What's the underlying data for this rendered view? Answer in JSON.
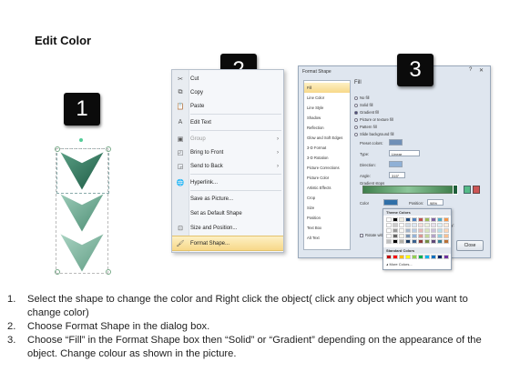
{
  "title": "Edit Color",
  "badges": [
    "1",
    "2",
    "3"
  ],
  "context_menu": {
    "items": [
      {
        "label": "Cut",
        "icon": "scissors-icon",
        "disabled": false,
        "submenu": false
      },
      {
        "label": "Copy",
        "icon": "copy-icon",
        "disabled": false,
        "submenu": false
      },
      {
        "label": "Paste",
        "icon": "paste-icon",
        "disabled": false,
        "submenu": false
      },
      {
        "label": "Edit Text",
        "icon": "text-edit-icon",
        "disabled": false,
        "submenu": false
      },
      {
        "label": "Group",
        "icon": "group-icon",
        "disabled": true,
        "submenu": true
      },
      {
        "label": "Bring to Front",
        "icon": "bring-front-icon",
        "disabled": false,
        "submenu": true
      },
      {
        "label": "Send to Back",
        "icon": "send-back-icon",
        "disabled": false,
        "submenu": true
      },
      {
        "label": "Hyperlink...",
        "icon": "hyperlink-icon",
        "disabled": false,
        "submenu": false
      },
      {
        "label": "Save as Picture...",
        "icon": "",
        "disabled": false,
        "submenu": false
      },
      {
        "label": "Set as Default Shape",
        "icon": "",
        "disabled": false,
        "submenu": false
      },
      {
        "label": "Size and Position...",
        "icon": "size-position-icon",
        "disabled": false,
        "submenu": false
      },
      {
        "label": "Format Shape...",
        "icon": "format-shape-icon",
        "disabled": false,
        "submenu": false,
        "highlighted": true
      }
    ]
  },
  "format_dialog": {
    "title": "Format Shape",
    "categories": [
      "Fill",
      "Line Color",
      "Line Style",
      "Shadow",
      "Reflection",
      "Glow and Soft Edges",
      "3-D Format",
      "3-D Rotation",
      "Picture Corrections",
      "Picture Color",
      "Artistic Effects",
      "Crop",
      "Size",
      "Position",
      "Text Box",
      "Alt Text"
    ],
    "selected_category": "Fill",
    "fill_heading": "Fill",
    "fill_options": [
      "No fill",
      "Solid fill",
      "Gradient fill",
      "Picture or texture fill",
      "Pattern fill",
      "Slide background fill"
    ],
    "selected_fill": "Gradient fill",
    "preset_colors_label": "Preset colors:",
    "type_label": "Type:",
    "type_value": "Linear",
    "direction_label": "Direction:",
    "angle_label": "Angle:",
    "angle_value": "315°",
    "gradient_stops_label": "Gradient stops",
    "color_label": "Color",
    "position_label": "Position:",
    "position_value": "98%",
    "brightness_label": "Brightness:",
    "transparency_label": "Transparency:",
    "rotate_label": "Rotate with shape",
    "close_label": "Close"
  },
  "palette": {
    "theme_label": "Theme Colors",
    "standard_label": "Standard Colors",
    "more_label": "More Colors...",
    "theme_top": [
      "#ffffff",
      "#000000",
      "#eeece1",
      "#1f497d",
      "#4f81bd",
      "#c0504d",
      "#9bbb59",
      "#8064a2",
      "#4bacc6",
      "#f79646"
    ],
    "standard": [
      "#c00000",
      "#ff0000",
      "#ffc000",
      "#ffff00",
      "#92d050",
      "#00b050",
      "#00b0f0",
      "#0070c0",
      "#002060",
      "#7030a0"
    ]
  },
  "instructions": [
    {
      "n": "1.",
      "text": "Select the shape to change the color and Right click the object( click any object which you want to change color)"
    },
    {
      "n": "2.",
      "text": "Choose Format Shape in the dialog box."
    },
    {
      "n": "3.",
      "text": "Choose “Fill” in the Format Shape box then “Solid” or “Gradient” depending on the appearance of the object. Change colour as shown in the picture."
    }
  ],
  "colors": {
    "shape_dark": "#2f7a5c",
    "shape_light": "#7fb7a0",
    "menu_highlight": "#f7d889"
  }
}
